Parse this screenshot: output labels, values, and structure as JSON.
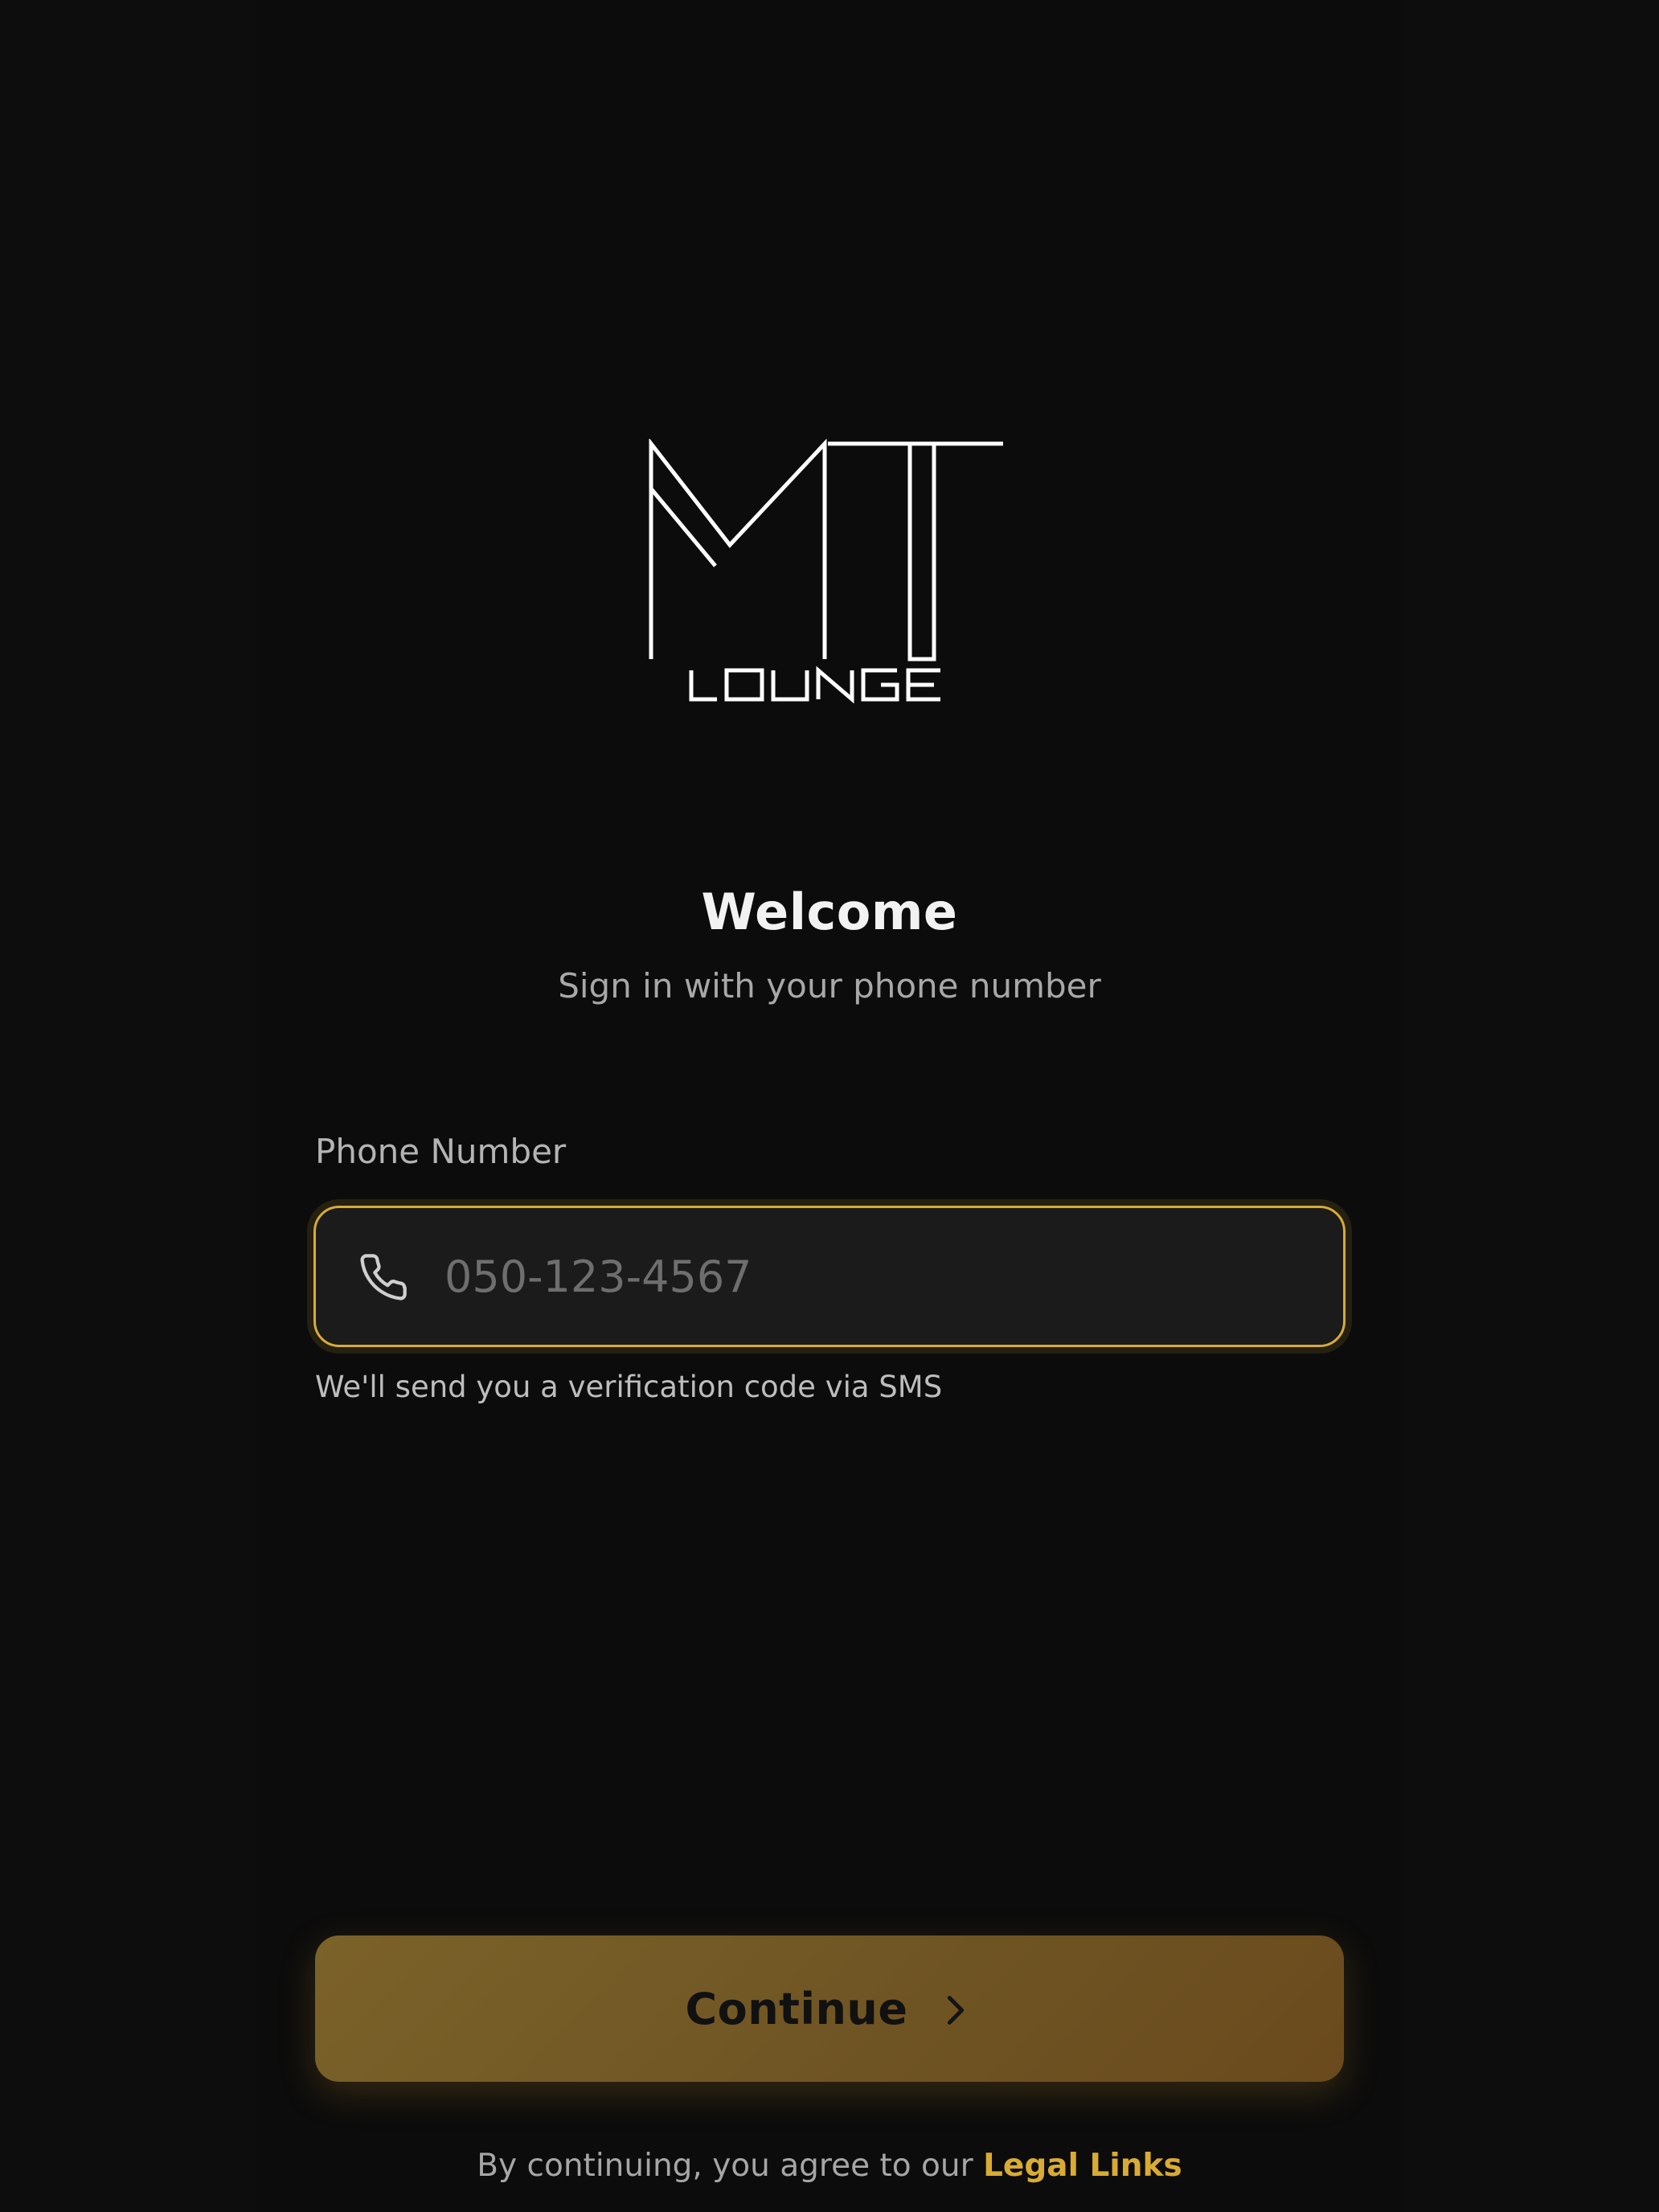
{
  "brand": {
    "logo_monogram": "MT",
    "logo_word": "LOUNGE",
    "accent_color": "#d6ac35"
  },
  "header": {
    "title": "Welcome",
    "subtitle": "Sign in with your phone number"
  },
  "phone_field": {
    "label": "Phone Number",
    "value": "",
    "placeholder": "050-123-4567",
    "icon": "phone-icon",
    "helper": "We'll send you a verification code via SMS"
  },
  "continue_button": {
    "label": "Continue",
    "icon": "chevron-right-icon"
  },
  "legal": {
    "prefix": "By continuing, you agree to our",
    "link_text": "Legal Links"
  }
}
